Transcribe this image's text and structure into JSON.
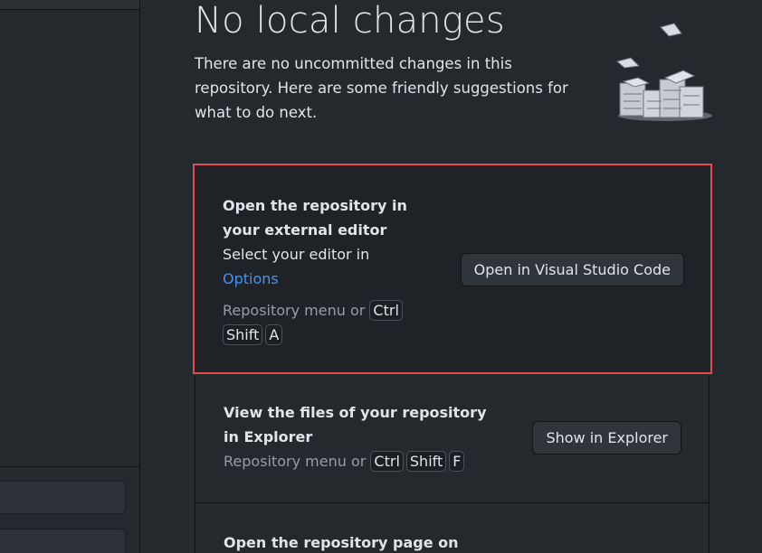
{
  "main": {
    "title": "No local changes",
    "subtitle": "There are no uncommitted changes in this repository. Here are some friendly suggestions for what to do next."
  },
  "cards": [
    {
      "title": "Open the repository in your external editor",
      "description_prefix": "Select your editor in",
      "description_link": "Options",
      "shortcut_prefix": "Repository menu or",
      "keys": [
        "Ctrl",
        "Shift",
        "A"
      ],
      "button_label": "Open in Visual Studio Code"
    },
    {
      "title": "View the files of your repository in Explorer",
      "shortcut_prefix": "Repository menu or",
      "keys": [
        "Ctrl",
        "Shift",
        "F"
      ],
      "button_label": "Show in Explorer"
    },
    {
      "title": "Open the repository page on GitHub"
    }
  ],
  "colors": {
    "background": "#24292e",
    "accent_link": "#4493f8",
    "highlight_border": "#e5484d"
  }
}
